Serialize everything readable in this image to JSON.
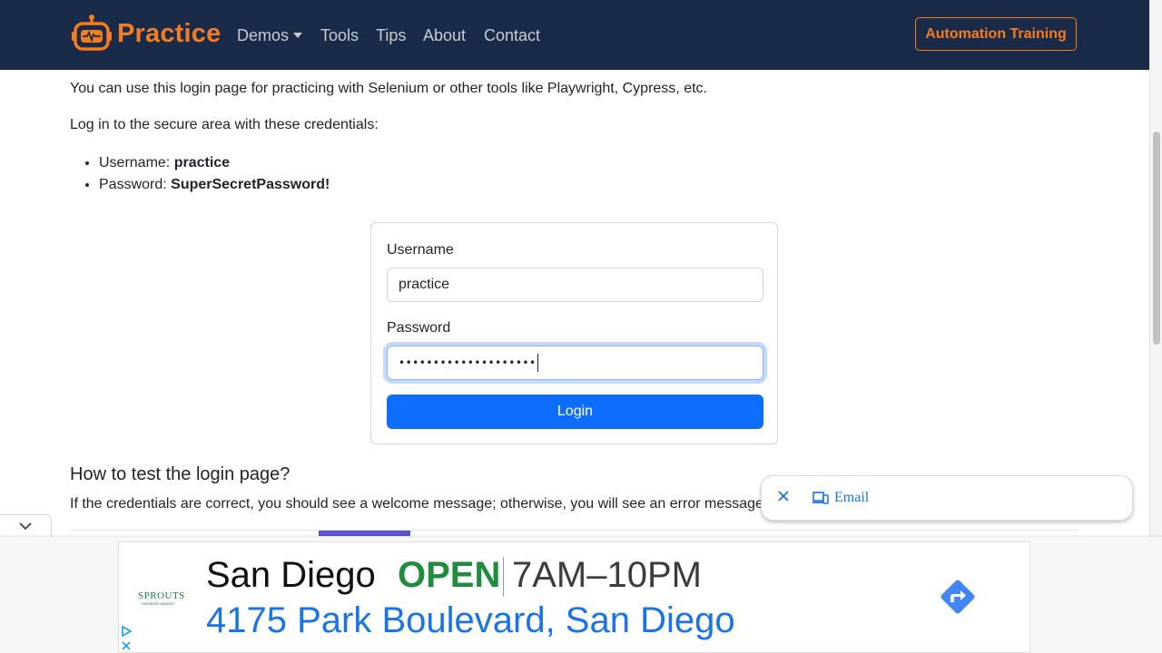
{
  "navbar": {
    "brand": "Practice",
    "items": [
      "Demos",
      "Tools",
      "Tips",
      "About",
      "Contact"
    ],
    "cta": "Automation Training",
    "colors": {
      "bg": "#1a2b49",
      "accent": "#f57c1f"
    }
  },
  "content": {
    "intro": "You can use this login page for practicing with Selenium or other tools like Playwright, Cypress, etc.",
    "instructions": "Log in to the secure area with these credentials:",
    "credentials": [
      {
        "label": "Username: ",
        "value": "practice"
      },
      {
        "label": "Password: ",
        "value": "SuperSecretPassword!"
      }
    ]
  },
  "form": {
    "username_label": "Username",
    "username_value": "practice",
    "password_label": "Password",
    "password_masked": "••••••••••••••••••••",
    "login_label": "Login"
  },
  "section": {
    "heading": "How to test the login page?",
    "body": "If the credentials are correct, you should see a welcome message; otherwise, you will see an error message."
  },
  "email_popup": {
    "label": "Email"
  },
  "ad": {
    "brand": "SPROUTS",
    "brand_sub": "FARMERS MARKET",
    "city": "San Diego",
    "status": "OPEN",
    "hours": "7AM–10PM",
    "address": "4175 Park Boulevard, San Diego"
  }
}
